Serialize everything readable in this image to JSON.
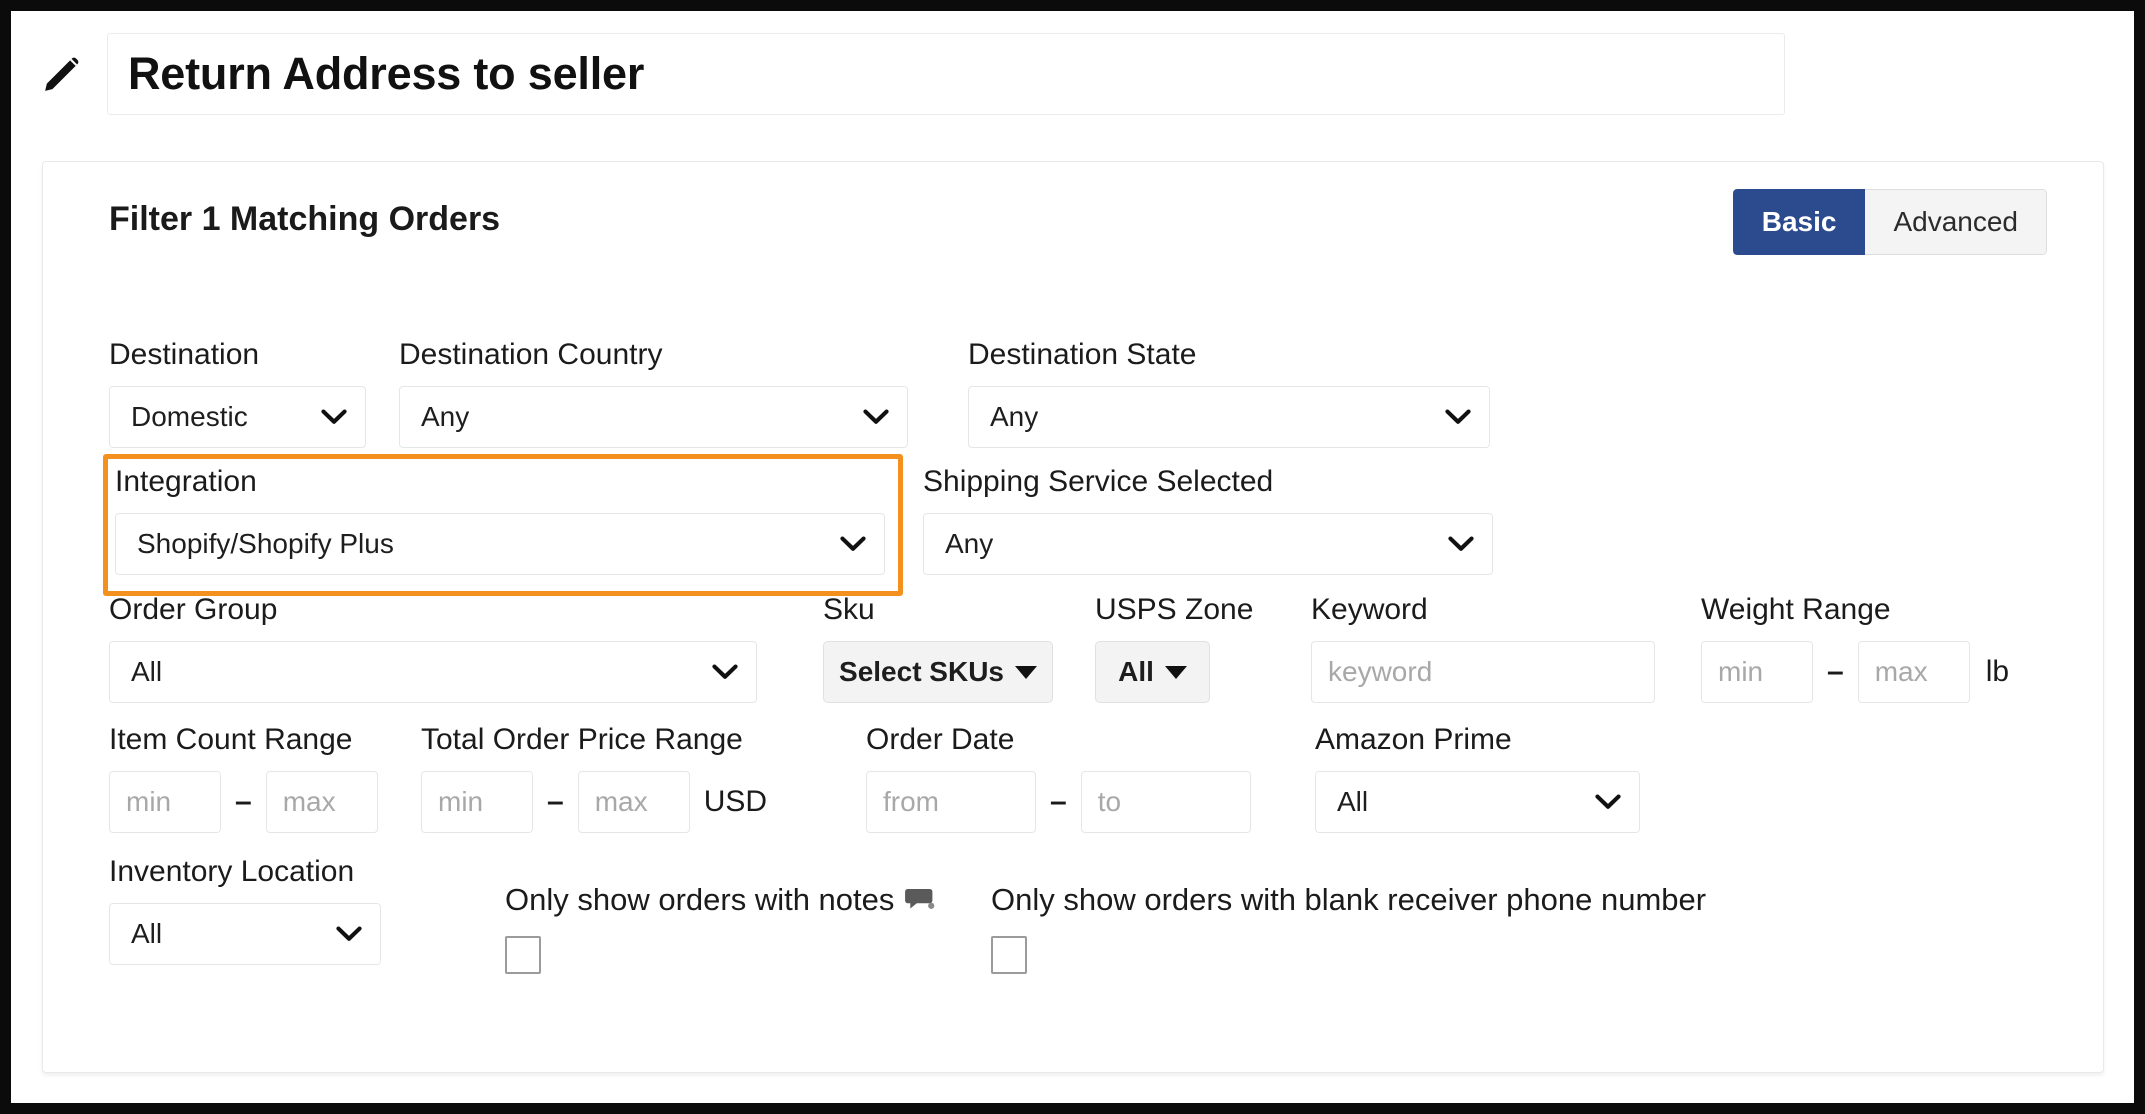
{
  "header": {
    "edit_icon": "pencil-icon",
    "title_value": "Return Address to seller"
  },
  "filter_card": {
    "title": "Filter 1 Matching Orders",
    "mode_toggle": {
      "basic_label": "Basic",
      "advanced_label": "Advanced",
      "selected": "Basic",
      "active_color": "#2c4b8e"
    },
    "highlight_color": "#f4911e",
    "fields": {
      "destination": {
        "label": "Destination",
        "value": "Domestic"
      },
      "destination_country": {
        "label": "Destination Country",
        "value": "Any"
      },
      "destination_state": {
        "label": "Destination State",
        "value": "Any"
      },
      "integration": {
        "label": "Integration",
        "value": "Shopify/Shopify Plus",
        "highlighted": true
      },
      "shipping_service_selected": {
        "label": "Shipping Service Selected",
        "value": "Any"
      },
      "order_group": {
        "label": "Order Group",
        "value": "All"
      },
      "sku": {
        "label": "Sku",
        "button_label": "Select SKUs"
      },
      "usps_zone": {
        "label": "USPS Zone",
        "button_label": "All"
      },
      "keyword": {
        "label": "Keyword",
        "placeholder": "keyword",
        "value": ""
      },
      "weight_range": {
        "label": "Weight Range",
        "min_placeholder": "min",
        "max_placeholder": "max",
        "separator": "–",
        "unit": "lb"
      },
      "item_count_range": {
        "label": "Item Count Range",
        "min_placeholder": "min",
        "max_placeholder": "max",
        "separator": "–"
      },
      "total_order_price_range": {
        "label": "Total Order Price Range",
        "min_placeholder": "min",
        "max_placeholder": "max",
        "separator": "–",
        "unit": "USD"
      },
      "order_date": {
        "label": "Order Date",
        "from_placeholder": "from",
        "to_placeholder": "to",
        "separator": "–"
      },
      "amazon_prime": {
        "label": "Amazon Prime",
        "value": "All"
      },
      "inventory_location": {
        "label": "Inventory Location",
        "value": "All"
      },
      "only_notes": {
        "label": "Only show orders with notes",
        "icon": "comment-icon",
        "checked": false
      },
      "only_blank_phone": {
        "label": "Only show orders with blank receiver phone number",
        "checked": false
      }
    }
  }
}
